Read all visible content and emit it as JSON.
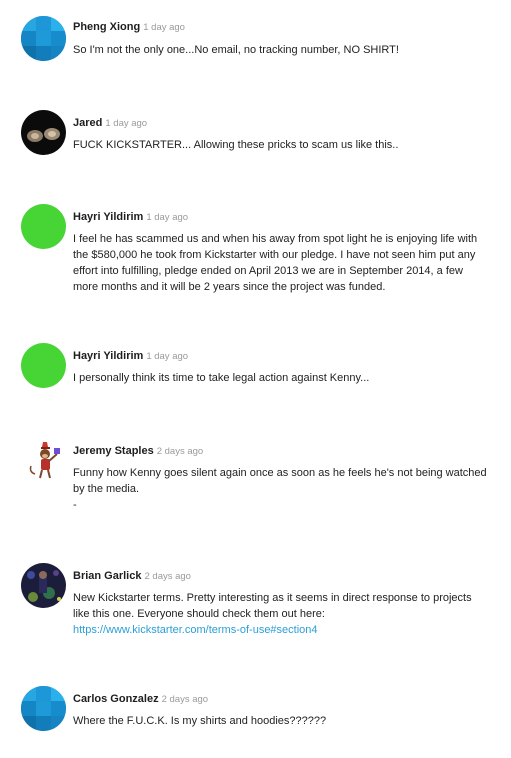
{
  "comments": [
    {
      "author": "Pheng Xiong",
      "time": "1 day ago",
      "avatar": "default-blue-mosaic",
      "text": "So I'm not the only one...No email, no tracking number, NO SHIRT!"
    },
    {
      "author": "Jared",
      "time": "1 day ago",
      "avatar": "photo-dark",
      "text": "FUCK KICKSTARTER... Allowing these pricks to scam us like this.."
    },
    {
      "author": "Hayri Yildirim",
      "time": "1 day ago",
      "avatar": "solid-green",
      "text": "I feel he has scammed us and when his away from spot light he is enjoying life with the $580,000 he took from Kickstarter with our pledge. I have not seen him put any effort into fulfilling, pledge ended on April 2013 we are in September 2014, a few more months and it will be 2 years since the project was funded."
    },
    {
      "author": "Hayri Yildirim",
      "time": "1 day ago",
      "avatar": "solid-green",
      "text": "I personally think its time to take legal action against Kenny..."
    },
    {
      "author": "Jeremy Staples",
      "time": "2 days ago",
      "avatar": "cartoon-monkey",
      "text": "Funny how Kenny goes silent again once as soon as he feels he's not being watched by the media.",
      "text2": "-"
    },
    {
      "author": "Brian Garlick",
      "time": "2 days ago",
      "avatar": "photo-night",
      "text": "New Kickstarter terms. Pretty interesting as it seems in direct response to projects like this one. Everyone should check them out here: ",
      "link": "https://www.kickstarter.com/terms-of-use#section4"
    },
    {
      "author": "Carlos Gonzalez",
      "time": "2 days ago",
      "avatar": "default-blue-mosaic",
      "text": "Where the F.U.C.K. Is my shirts and hoodies??????"
    }
  ],
  "colors": {
    "link": "#2a9fd6",
    "timestamp": "#9a9a9a",
    "green_avatar": "#46d535",
    "blue_avatar": "#1a8fd0"
  }
}
